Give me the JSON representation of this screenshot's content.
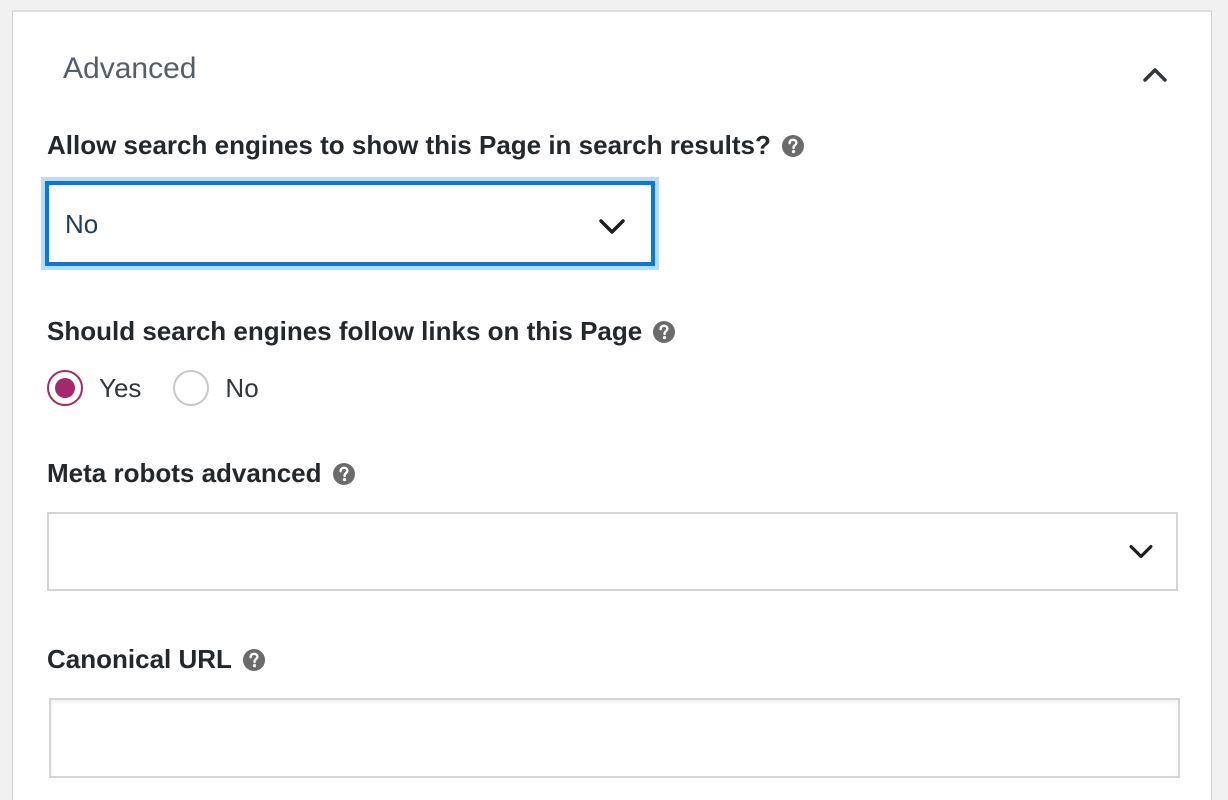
{
  "section": {
    "title": "Advanced",
    "collapse_icon": "chevron-up-icon"
  },
  "search_visibility": {
    "label": "Allow search engines to show this Page in search results?",
    "help_icon": "question-circle-icon",
    "selected_value": "No",
    "dropdown_icon": "chevron-down-icon"
  },
  "follow_links": {
    "label": "Should search engines follow links on this Page",
    "help_icon": "question-circle-icon",
    "options": [
      {
        "label": "Yes",
        "checked": true
      },
      {
        "label": "No",
        "checked": false
      }
    ]
  },
  "meta_robots": {
    "label": "Meta robots advanced",
    "help_icon": "question-circle-icon",
    "selected_value": "",
    "dropdown_icon": "chevron-down-icon"
  },
  "canonical": {
    "label": "Canonical URL",
    "help_icon": "question-circle-icon",
    "value": "",
    "placeholder": ""
  },
  "colors": {
    "focus_border": "#0a77dd",
    "focus_halo": "#b7dcff",
    "radio_accent": "#a4286a",
    "help_icon": "#6b6b6b"
  }
}
